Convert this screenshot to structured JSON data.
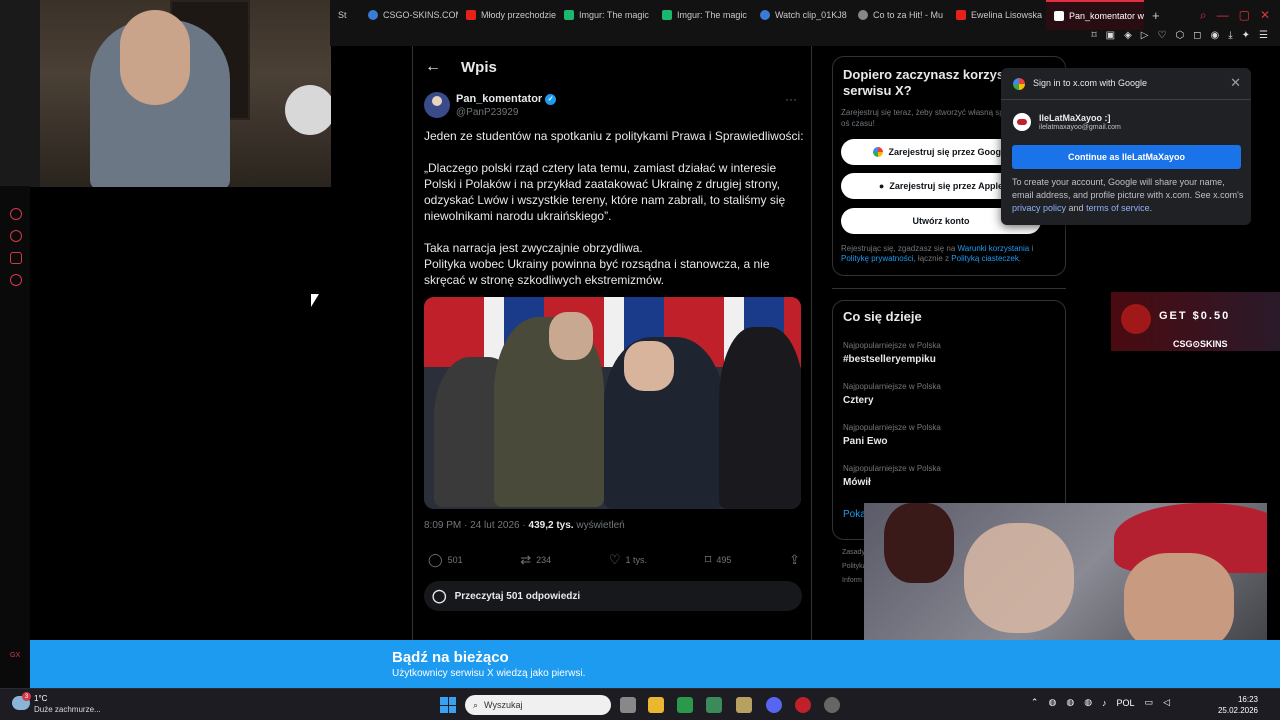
{
  "browser": {
    "tabs": [
      {
        "label": "St",
        "color": "#555555"
      },
      {
        "label": "CSGO-SKINS.COM",
        "color": "#3a7bd5"
      },
      {
        "label": "Młody przechodzień",
        "color": "#e62117"
      },
      {
        "label": "Imgur: The magic",
        "color": "#1bb76e"
      },
      {
        "label": "Imgur: The magic",
        "color": "#1bb76e"
      },
      {
        "label": "Watch clip_01KJ8",
        "color": "#3a7bd5"
      },
      {
        "label": "Co to za Hit! - Mu",
        "color": "#888888"
      },
      {
        "label": "Ewelina Lisowska",
        "color": "#e62117"
      },
      {
        "label": "Pan_komentator w serwisie X",
        "color": "#ffffff",
        "active": true
      }
    ],
    "new_tab": "+"
  },
  "tweet": {
    "header": "Wpis",
    "back_icon": "←",
    "author": "Pan_komentator",
    "handle": "@PanP23929",
    "more_icon": "···",
    "text": "Jeden ze studentów na spotkaniu z politykami Prawa i Sprawiedliwości:\n\n„Dlaczego polski rząd cztery lata temu, zamiast działać w interesie Polski i Polaków i na przykład zaatakować Ukrainę z drugiej strony, odzyskać Lwów i wszystkie tereny, które nam zabrali, to staliśmy się niewolnikami narodu ukraińskiego”.\n\nTaka narracja jest zwyczajnie obrzydliwa.\nPolityka wobec Ukrainy powinna być rozsądna i stanowcza, a nie skręcać w stronę szkodliwych ekstremizmów.",
    "time": "8:09 PM · 24 lut 2026 · ",
    "views_count": "439,2 tys.",
    "views_label": " wyświetleń",
    "stats": {
      "replies": "501",
      "reposts": "234",
      "likes": "1 tys.",
      "bookmarks": "495"
    },
    "read_replies": "Przeczytaj 501 odpowiedzi"
  },
  "signup": {
    "title": "Dopiero zaczynasz korzystać z serwisu X?",
    "subtitle": "Zarejestruj się teraz, żeby stworzyć własną spersonalizowaną oś czasu!",
    "google_btn": "Zarejestruj się przez Google",
    "apple_btn": "Zarejestruj się przez Apple",
    "create_btn": "Utwórz konto",
    "legal_prefix": "Rejestrując się, zgadzasz się na ",
    "terms": "Warunki korzystania",
    "legal_mid": " i ",
    "privacy": "Politykę prywatności",
    "legal_mid2": ", łącznie z ",
    "cookies": "Polityką ciasteczek",
    "legal_end": "."
  },
  "trends": {
    "title": "Co się dzieje",
    "items": [
      {
        "category": "Najpopularniejsze w Polska",
        "name": "#bestselleryempiku"
      },
      {
        "category": "Najpopularniejsze w Polska",
        "name": "Cztery"
      },
      {
        "category": "Najpopularniejsze w Polska",
        "name": "Pani Ewo"
      },
      {
        "category": "Najpopularniejsze w Polska",
        "name": "Mówił"
      }
    ],
    "show_more": "Pokaż"
  },
  "footer_links": [
    "Zasady",
    "Polityka",
    "Inform"
  ],
  "google_popup": {
    "title": "Sign in to x.com with Google",
    "close_icon": "✕",
    "account_name": "IleLatMaXayoo :]",
    "account_email": "ilelatmaxayoo@gmail.com",
    "continue_btn": "Continue as IleLatMaXayoo",
    "info_prefix": "To create your account, Google will share your name, email address, and profile picture with x.com. See x.com's ",
    "privacy": "privacy policy",
    "and": " and ",
    "terms": "terms of service",
    "end": "."
  },
  "ad": {
    "get": "GET $0.50",
    "brand": "CSG⊙SKINS"
  },
  "banner": {
    "title": "Bądź na bieżąco",
    "subtitle": "Użytkownicy serwisu X wiedzą jako pierwsi."
  },
  "sidebar": {
    "label": "GX"
  },
  "taskbar": {
    "weather_badge": "3",
    "temp": "1°C",
    "weather": "Duże zachmurze...",
    "search_placeholder": "Wyszukaj",
    "lang": "POL",
    "time": "16:23",
    "date": "25.02.2026"
  },
  "colors": {
    "x_blue": "#1d9bf0",
    "opera_red": "#e0303d",
    "google_blue": "#1a73e8"
  }
}
